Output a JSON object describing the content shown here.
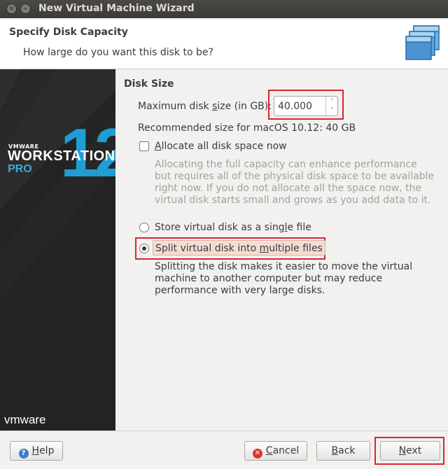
{
  "window": {
    "title": "New Virtual Machine Wizard"
  },
  "header": {
    "title": "Specify Disk Capacity",
    "subtitle": "How large do you want this disk to be?"
  },
  "banner": {
    "brand_small": "VMWARE",
    "product": "WORKSTATION",
    "edition": "PRO",
    "version": "12",
    "logo": "vmware"
  },
  "disk_size": {
    "section_title": "Disk Size",
    "max_label_pre": "Maximum disk ",
    "max_label_u": "s",
    "max_label_post": "ize (in GB):",
    "value": "40.000",
    "recommended": "Recommended size for macOS 10.12: 40 GB"
  },
  "allocate": {
    "label_u": "A",
    "label_rest": "llocate all disk space now",
    "checked": false,
    "description": "Allocating the full capacity can enhance performance but requires all of the physical disk space to be available right now. If you do not allocate all the space now, the virtual disk starts small and grows as you add data to it."
  },
  "storage": {
    "single_pre": "Store virtual disk as a sing",
    "single_u": "l",
    "single_post": "e file",
    "split_pre": "Split virtual disk into ",
    "split_u": "m",
    "split_post": "ultiple files",
    "selected": "split",
    "split_description": "Splitting the disk makes it easier to move the virtual machine to another computer but may reduce performance with very large disks."
  },
  "buttons": {
    "help_u": "H",
    "help_rest": "elp",
    "cancel_u": "C",
    "cancel_rest": "ancel",
    "back_u": "B",
    "back_rest": "ack",
    "next_u": "N",
    "next_rest": "ext"
  },
  "colors": {
    "highlight": "#d9262f",
    "accent": "#1e9ed3",
    "titlebar": "#3c3b37"
  }
}
